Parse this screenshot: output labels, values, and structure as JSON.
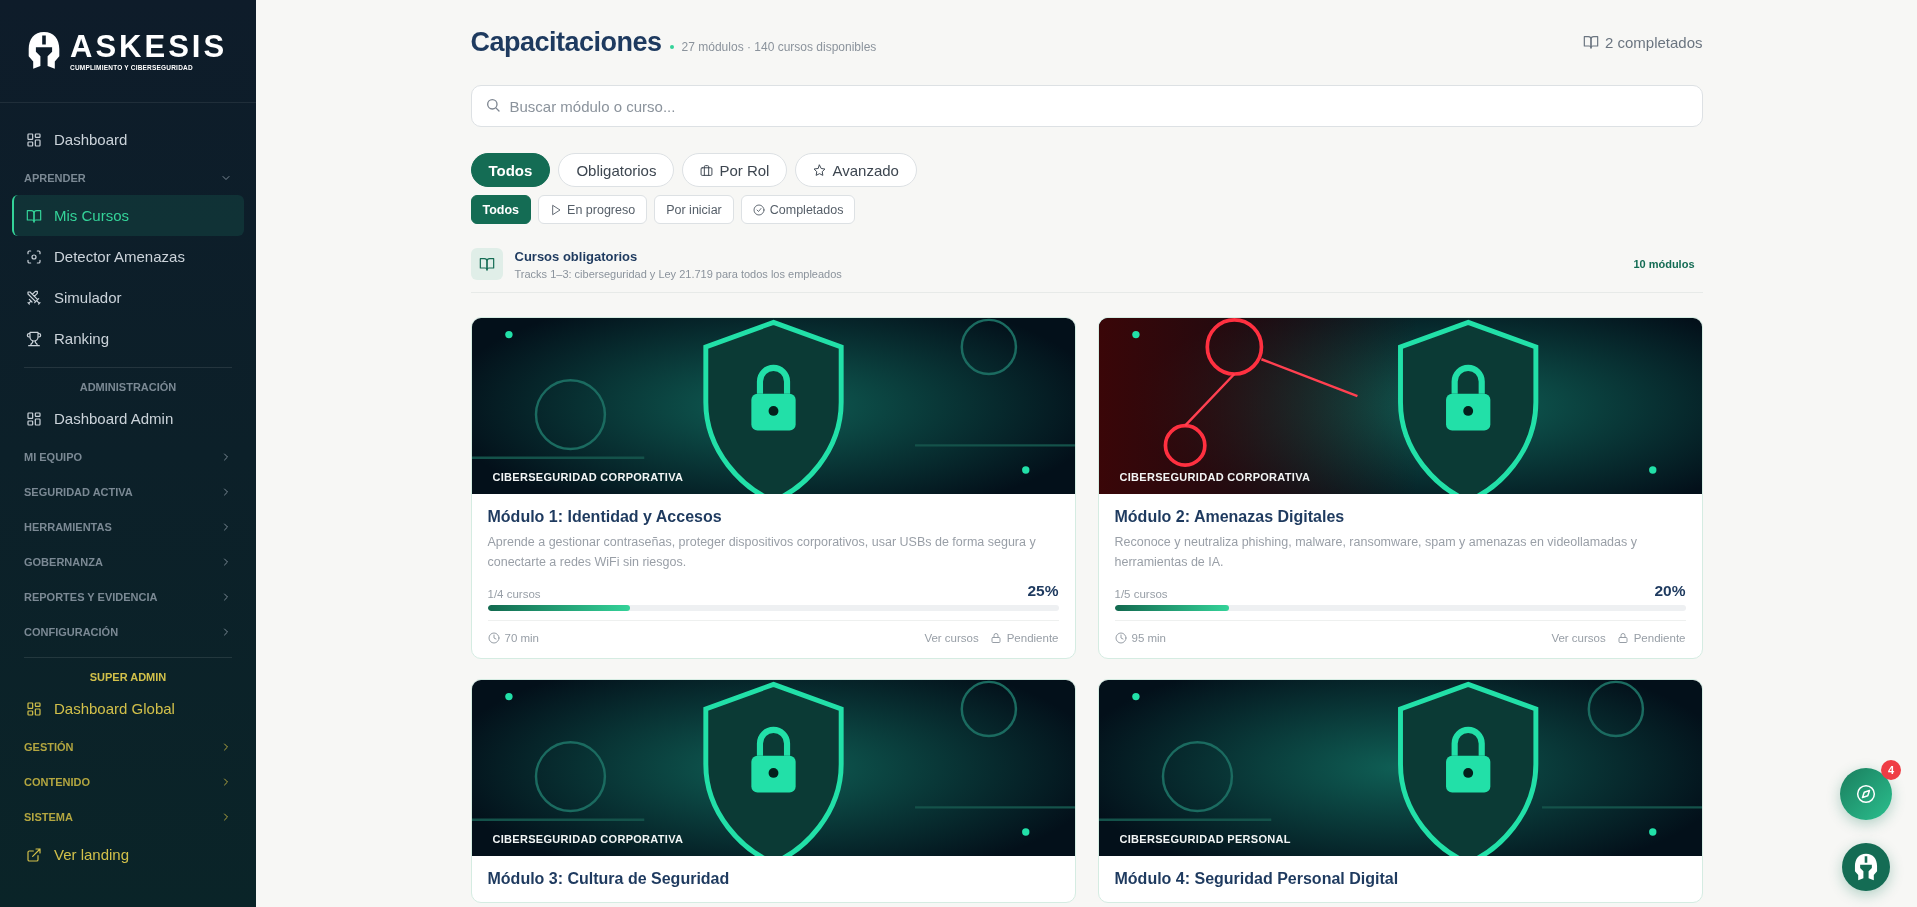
{
  "sidebar": {
    "logo": {
      "name": "ASKESIS",
      "tagline": "CUMPLIMIENTO Y CIBERSEGURIDAD"
    },
    "sections": [
      {
        "accent": false,
        "items": [
          {
            "kind": "link",
            "label": "Dashboard",
            "selected": false
          },
          {
            "kind": "group",
            "label": "APRENDER",
            "expanded": true
          },
          {
            "kind": "link",
            "label": "Mis Cursos",
            "selected": true
          },
          {
            "kind": "link",
            "label": "Detector Amenazas",
            "selected": false
          },
          {
            "kind": "link",
            "label": "Simulador",
            "selected": false
          },
          {
            "kind": "link",
            "label": "Ranking",
            "selected": false
          }
        ]
      },
      {
        "accent": false,
        "heading": "ADMINISTRACIÓN",
        "items": [
          {
            "kind": "link",
            "label": "Dashboard Admin",
            "selected": false
          },
          {
            "kind": "group",
            "label": "MI EQUIPO",
            "expanded": false
          },
          {
            "kind": "group",
            "label": "SEGURIDAD ACTIVA",
            "expanded": false
          },
          {
            "kind": "group",
            "label": "HERRAMIENTAS",
            "expanded": false
          },
          {
            "kind": "group",
            "label": "GOBERNANZA",
            "expanded": false
          },
          {
            "kind": "group",
            "label": "REPORTES Y EVIDENCIA",
            "expanded": false
          },
          {
            "kind": "group",
            "label": "CONFIGURACIÓN",
            "expanded": false
          }
        ]
      },
      {
        "accent": true,
        "heading": "SUPER ADMIN",
        "items": [
          {
            "kind": "link",
            "label": "Dashboard Global",
            "selected": false
          },
          {
            "kind": "group",
            "label": "GESTIÓN",
            "expanded": false
          },
          {
            "kind": "group",
            "label": "CONTENIDO",
            "expanded": false
          },
          {
            "kind": "group",
            "label": "SISTEMA",
            "expanded": false
          },
          {
            "kind": "link",
            "label": "Ver landing",
            "selected": false
          }
        ]
      }
    ]
  },
  "header": {
    "title": "Capacitaciones",
    "subtitle": "27 módulos · 140 cursos disponibles",
    "completed": "2 completados"
  },
  "search": {
    "placeholder": "Buscar módulo o curso..."
  },
  "category_filters": [
    {
      "label": "Todos",
      "selected": true
    },
    {
      "label": "Obligatorios",
      "selected": false
    },
    {
      "label": "Por Rol",
      "selected": false
    },
    {
      "label": "Avanzado",
      "selected": false
    }
  ],
  "status_filters": [
    {
      "label": "Todos",
      "selected": true
    },
    {
      "label": "En progreso",
      "selected": false
    },
    {
      "label": "Por iniciar",
      "selected": false
    },
    {
      "label": "Completados",
      "selected": false
    }
  ],
  "section": {
    "title": "Cursos obligatorios",
    "subtitle": "Tracks 1–3: ciberseguridad y Ley 21.719 para todos los empleados",
    "count": "10 módulos"
  },
  "modules": [
    {
      "category": "CIBERSEGURIDAD CORPORATIVA",
      "title": "Módulo 1: Identidad y Accesos",
      "description": "Aprende a gestionar contraseñas, proteger dispositivos corporativos, usar USBs de forma segura y conectarte a redes WiFi sin riesgos.",
      "progress_text": "1/4 cursos",
      "percent": "25%",
      "level": 0.25,
      "duration": "70 min",
      "link": "Ver cursos",
      "status": "Pendiente"
    },
    {
      "category": "CIBERSEGURIDAD CORPORATIVA",
      "title": "Módulo 2: Amenazas Digitales",
      "description": "Reconoce y neutraliza phishing, malware, ransomware, spam y amenazas en videollamadas y herramientas de IA.",
      "progress_text": "1/5 cursos",
      "percent": "20%",
      "level": 0.2,
      "duration": "95 min",
      "link": "Ver cursos",
      "status": "Pendiente"
    },
    {
      "category": "CIBERSEGURIDAD CORPORATIVA",
      "title": "Módulo 3: Cultura de Seguridad"
    },
    {
      "category": "CIBERSEGURIDAD PERSONAL",
      "title": "Módulo 4: Seguridad Personal Digital"
    }
  ],
  "assistant": {
    "badge": "4"
  }
}
